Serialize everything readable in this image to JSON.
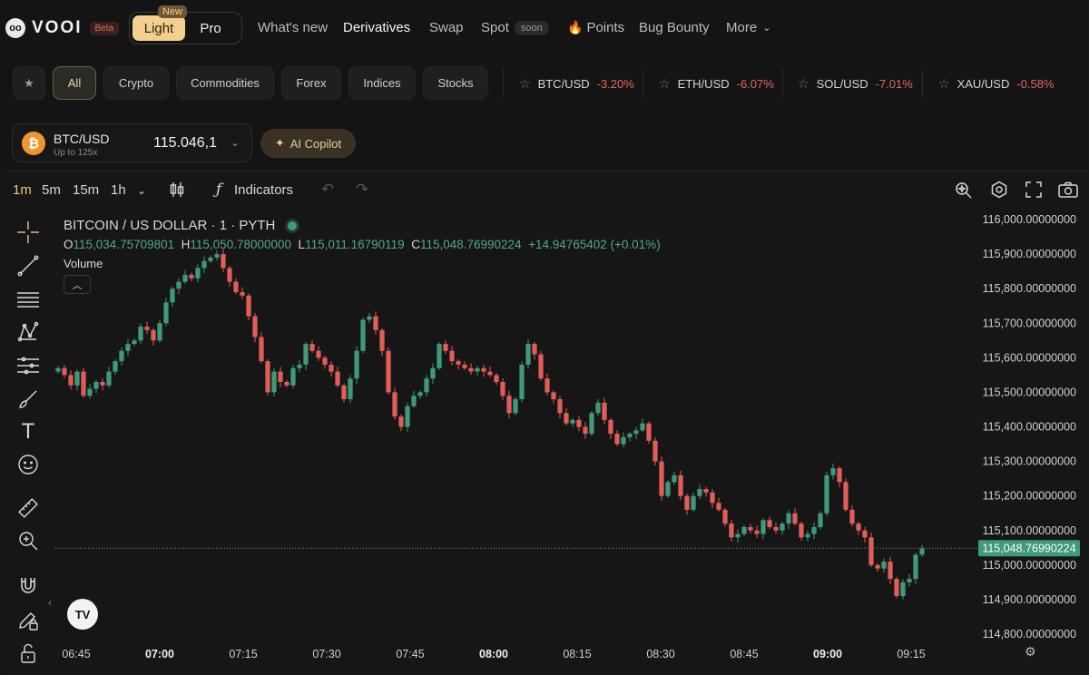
{
  "brand": {
    "name": "VOOI",
    "badge": "Beta"
  },
  "mode": {
    "light": "Light",
    "new_badge": "New",
    "pro": "Pro"
  },
  "nav": {
    "whats_new": "What's new",
    "derivatives": "Derivatives",
    "swap": "Swap",
    "spot": "Spot",
    "spot_badge": "soon",
    "points": "Points",
    "bug_bounty": "Bug Bounty",
    "more": "More"
  },
  "filters": [
    "All",
    "Crypto",
    "Commodities",
    "Forex",
    "Indices",
    "Stocks"
  ],
  "tickers": [
    {
      "symbol": "BTC/USD",
      "change": "-3.20%"
    },
    {
      "symbol": "ETH/USD",
      "change": "-6.07%"
    },
    {
      "symbol": "SOL/USD",
      "change": "-7.01%"
    },
    {
      "symbol": "XAU/USD",
      "change": "-0.58%"
    }
  ],
  "market": {
    "symbol": "BTC/USD",
    "leverage": "Up to 125x",
    "price": "115.046,1"
  },
  "copilot": "AI Copilot",
  "toolbar": {
    "intervals": [
      "1m",
      "5m",
      "15m",
      "1h"
    ],
    "indicators": "Indicators"
  },
  "legend": {
    "title": "BITCOIN / US DOLLAR · 1 · PYTH",
    "o_label": "O",
    "o": "115,034.75709801",
    "h_label": "H",
    "h": "115,050.78000000",
    "l_label": "L",
    "l": "115,011.16790119",
    "c_label": "C",
    "c": "115,048.76990224",
    "change": "+14.94765402 (+0.01%)",
    "volume": "Volume"
  },
  "colors": {
    "up": "#3f9a7a",
    "down": "#e05d58",
    "accent": "#f4cf8f",
    "price_tag": "#3f9a7a"
  },
  "chart_data": {
    "type": "candlestick",
    "ylim": [
      114800,
      116000
    ],
    "y_ticks": [
      "116,000.00000000",
      "115,900.00000000",
      "115,800.00000000",
      "115,700.00000000",
      "115,600.00000000",
      "115,500.00000000",
      "115,400.00000000",
      "115,300.00000000",
      "115,200.00000000",
      "115,100.00000000",
      "115,000.00000000",
      "114,900.00000000",
      "114,800.00000000"
    ],
    "y_tick_values": [
      116000,
      115900,
      115800,
      115700,
      115600,
      115500,
      115400,
      115300,
      115200,
      115100,
      115000,
      114900,
      114800
    ],
    "x_ticks": [
      "06:45",
      "07:00",
      "07:15",
      "07:30",
      "07:45",
      "08:00",
      "08:15",
      "08:30",
      "08:45",
      "09:00",
      "09:15"
    ],
    "x_tick_bold": [
      false,
      true,
      false,
      false,
      false,
      true,
      false,
      false,
      false,
      true,
      false
    ],
    "last_price": 115048.76990224,
    "last_price_label": "115,048.76990224",
    "closes": [
      115570,
      115550,
      115520,
      115560,
      115490,
      115510,
      115530,
      115520,
      115560,
      115590,
      115620,
      115640,
      115650,
      115690,
      115680,
      115650,
      115700,
      115760,
      115800,
      115820,
      115840,
      115830,
      115860,
      115880,
      115890,
      115900,
      115860,
      115820,
      115790,
      115780,
      115720,
      115660,
      115590,
      115500,
      115560,
      115530,
      115520,
      115570,
      115580,
      115640,
      115620,
      115600,
      115580,
      115560,
      115520,
      115480,
      115540,
      115620,
      115710,
      115720,
      115680,
      115620,
      115500,
      115430,
      115400,
      115460,
      115490,
      115500,
      115540,
      115570,
      115640,
      115620,
      115590,
      115580,
      115570,
      115560,
      115570,
      115560,
      115550,
      115530,
      115490,
      115440,
      115480,
      115580,
      115640,
      115610,
      115540,
      115500,
      115480,
      115440,
      115410,
      115420,
      115400,
      115380,
      115440,
      115470,
      115420,
      115380,
      115350,
      115370,
      115380,
      115390,
      115410,
      115360,
      115300,
      115200,
      115240,
      115260,
      115200,
      115160,
      115200,
      115220,
      115210,
      115180,
      115160,
      115120,
      115080,
      115090,
      115110,
      115100,
      115090,
      115130,
      115110,
      115100,
      115120,
      115150,
      115120,
      115080,
      115090,
      115110,
      115150,
      115260,
      115280,
      115240,
      115160,
      115120,
      115100,
      115080,
      115000,
      114990,
      115010,
      114960,
      114910,
      114950,
      114960,
      115030,
      115048
    ]
  }
}
